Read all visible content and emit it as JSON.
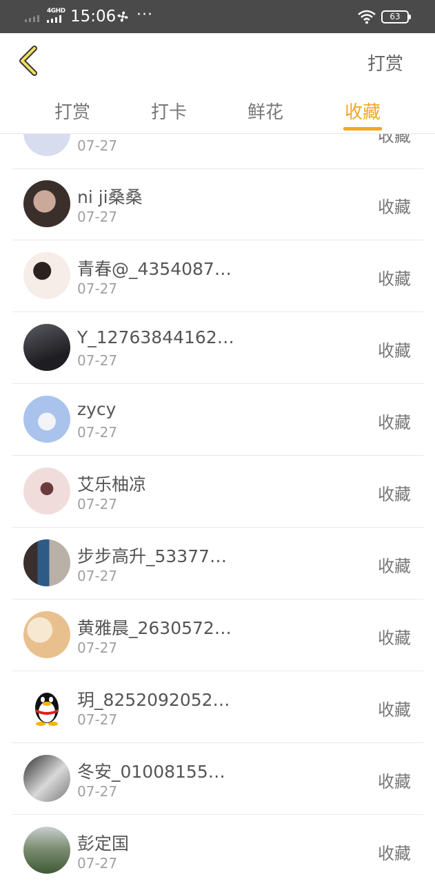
{
  "status_bar": {
    "network": "4GHD",
    "time": "15:06",
    "dots": "···",
    "battery": "63"
  },
  "header": {
    "action_label": "打赏"
  },
  "tabs": [
    {
      "label": "打赏"
    },
    {
      "label": "打卡"
    },
    {
      "label": "鲜花"
    },
    {
      "label": "收藏",
      "active": true
    }
  ],
  "accent_color": "#f5a623",
  "list": {
    "items": [
      {
        "name": "",
        "date": "07-27",
        "action": "收藏",
        "avatar_color": "#d7dcef"
      },
      {
        "name": "ni ji桑桑",
        "date": "07-27",
        "action": "收藏",
        "avatar_color": "#4a3b36"
      },
      {
        "name": "青春@_4354087…",
        "date": "07-27",
        "action": "收藏",
        "avatar_color": "#f3e8e6"
      },
      {
        "name": "Y_12763844162…",
        "date": "07-27",
        "action": "收藏",
        "avatar_color": "#2a2a2e"
      },
      {
        "name": "zycy",
        "date": "07-27",
        "action": "收藏",
        "avatar_color": "#a9c3ec"
      },
      {
        "name": "艾乐柚凉",
        "date": "07-27",
        "action": "收藏",
        "avatar_color": "#e9c9c9"
      },
      {
        "name": "步步高升_53377…",
        "date": "07-27",
        "action": "收藏",
        "avatar_color": "#5a4b45"
      },
      {
        "name": "黄雅晨_2630572…",
        "date": "07-27",
        "action": "收藏",
        "avatar_color": "#f1d6b8"
      },
      {
        "name": "玥_8252092052…",
        "date": "07-27",
        "action": "收藏",
        "avatar_color": "#ffffff"
      },
      {
        "name": "冬安_01008155…",
        "date": "07-27",
        "action": "收藏",
        "avatar_color": "#9a9a9a"
      },
      {
        "name": "彭定国",
        "date": "07-27",
        "action": "收藏",
        "avatar_color": "#7e8f74"
      }
    ]
  }
}
